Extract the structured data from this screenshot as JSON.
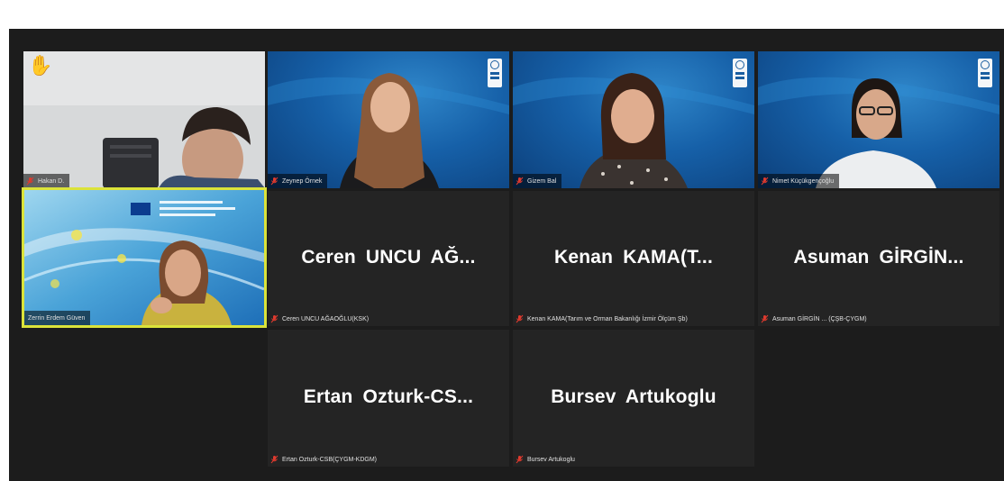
{
  "colors": {
    "background": "#1c1c1c",
    "tile": "#242424",
    "active_border": "#dbe33a",
    "un_blue": "#1660a8",
    "mic_muted": "#e03a2e",
    "raise_hand": "#f7c21b"
  },
  "participants": [
    {
      "display_name": "",
      "label": "Hakan D.",
      "video": true,
      "raised_hand": true,
      "muted": true
    },
    {
      "display_name": "",
      "label": "Zeynep Örnek",
      "video": true,
      "muted": true,
      "background": "un-logo"
    },
    {
      "display_name": "",
      "label": "Gizem Bal",
      "video": true,
      "muted": true,
      "background": "un-logo"
    },
    {
      "display_name": "",
      "label": "Nimet Küçükgençoğlu",
      "video": true,
      "muted": true,
      "background": "un-logo"
    },
    {
      "display_name": "",
      "label": "Zerrin Erdem Güven",
      "video": true,
      "active_speaker": true
    },
    {
      "display_name": "Ceren UNCU AĞ...",
      "label": "Ceren UNCU AĞAOĞLU(KSK)",
      "video": false,
      "muted": true
    },
    {
      "display_name": "Kenan KAMA(T...",
      "label": "Kenan KAMA(Tarım ve Orman Bakanlığı İzmir Ölçüm Şb)",
      "video": false,
      "muted": true
    },
    {
      "display_name": "Asuman GİRGİN...",
      "label": "Asuman GİRGİN ... (ÇŞB-ÇYGM)",
      "video": false,
      "muted": true
    },
    {
      "display_name": "Ertan Ozturk-CS...",
      "label": "Ertan Ozturk-CSB(ÇYGM-KDGM)",
      "video": false,
      "muted": true
    },
    {
      "display_name": "Bursev Artukoglu",
      "label": "Bursev Artukoglu",
      "video": false,
      "muted": true
    }
  ]
}
